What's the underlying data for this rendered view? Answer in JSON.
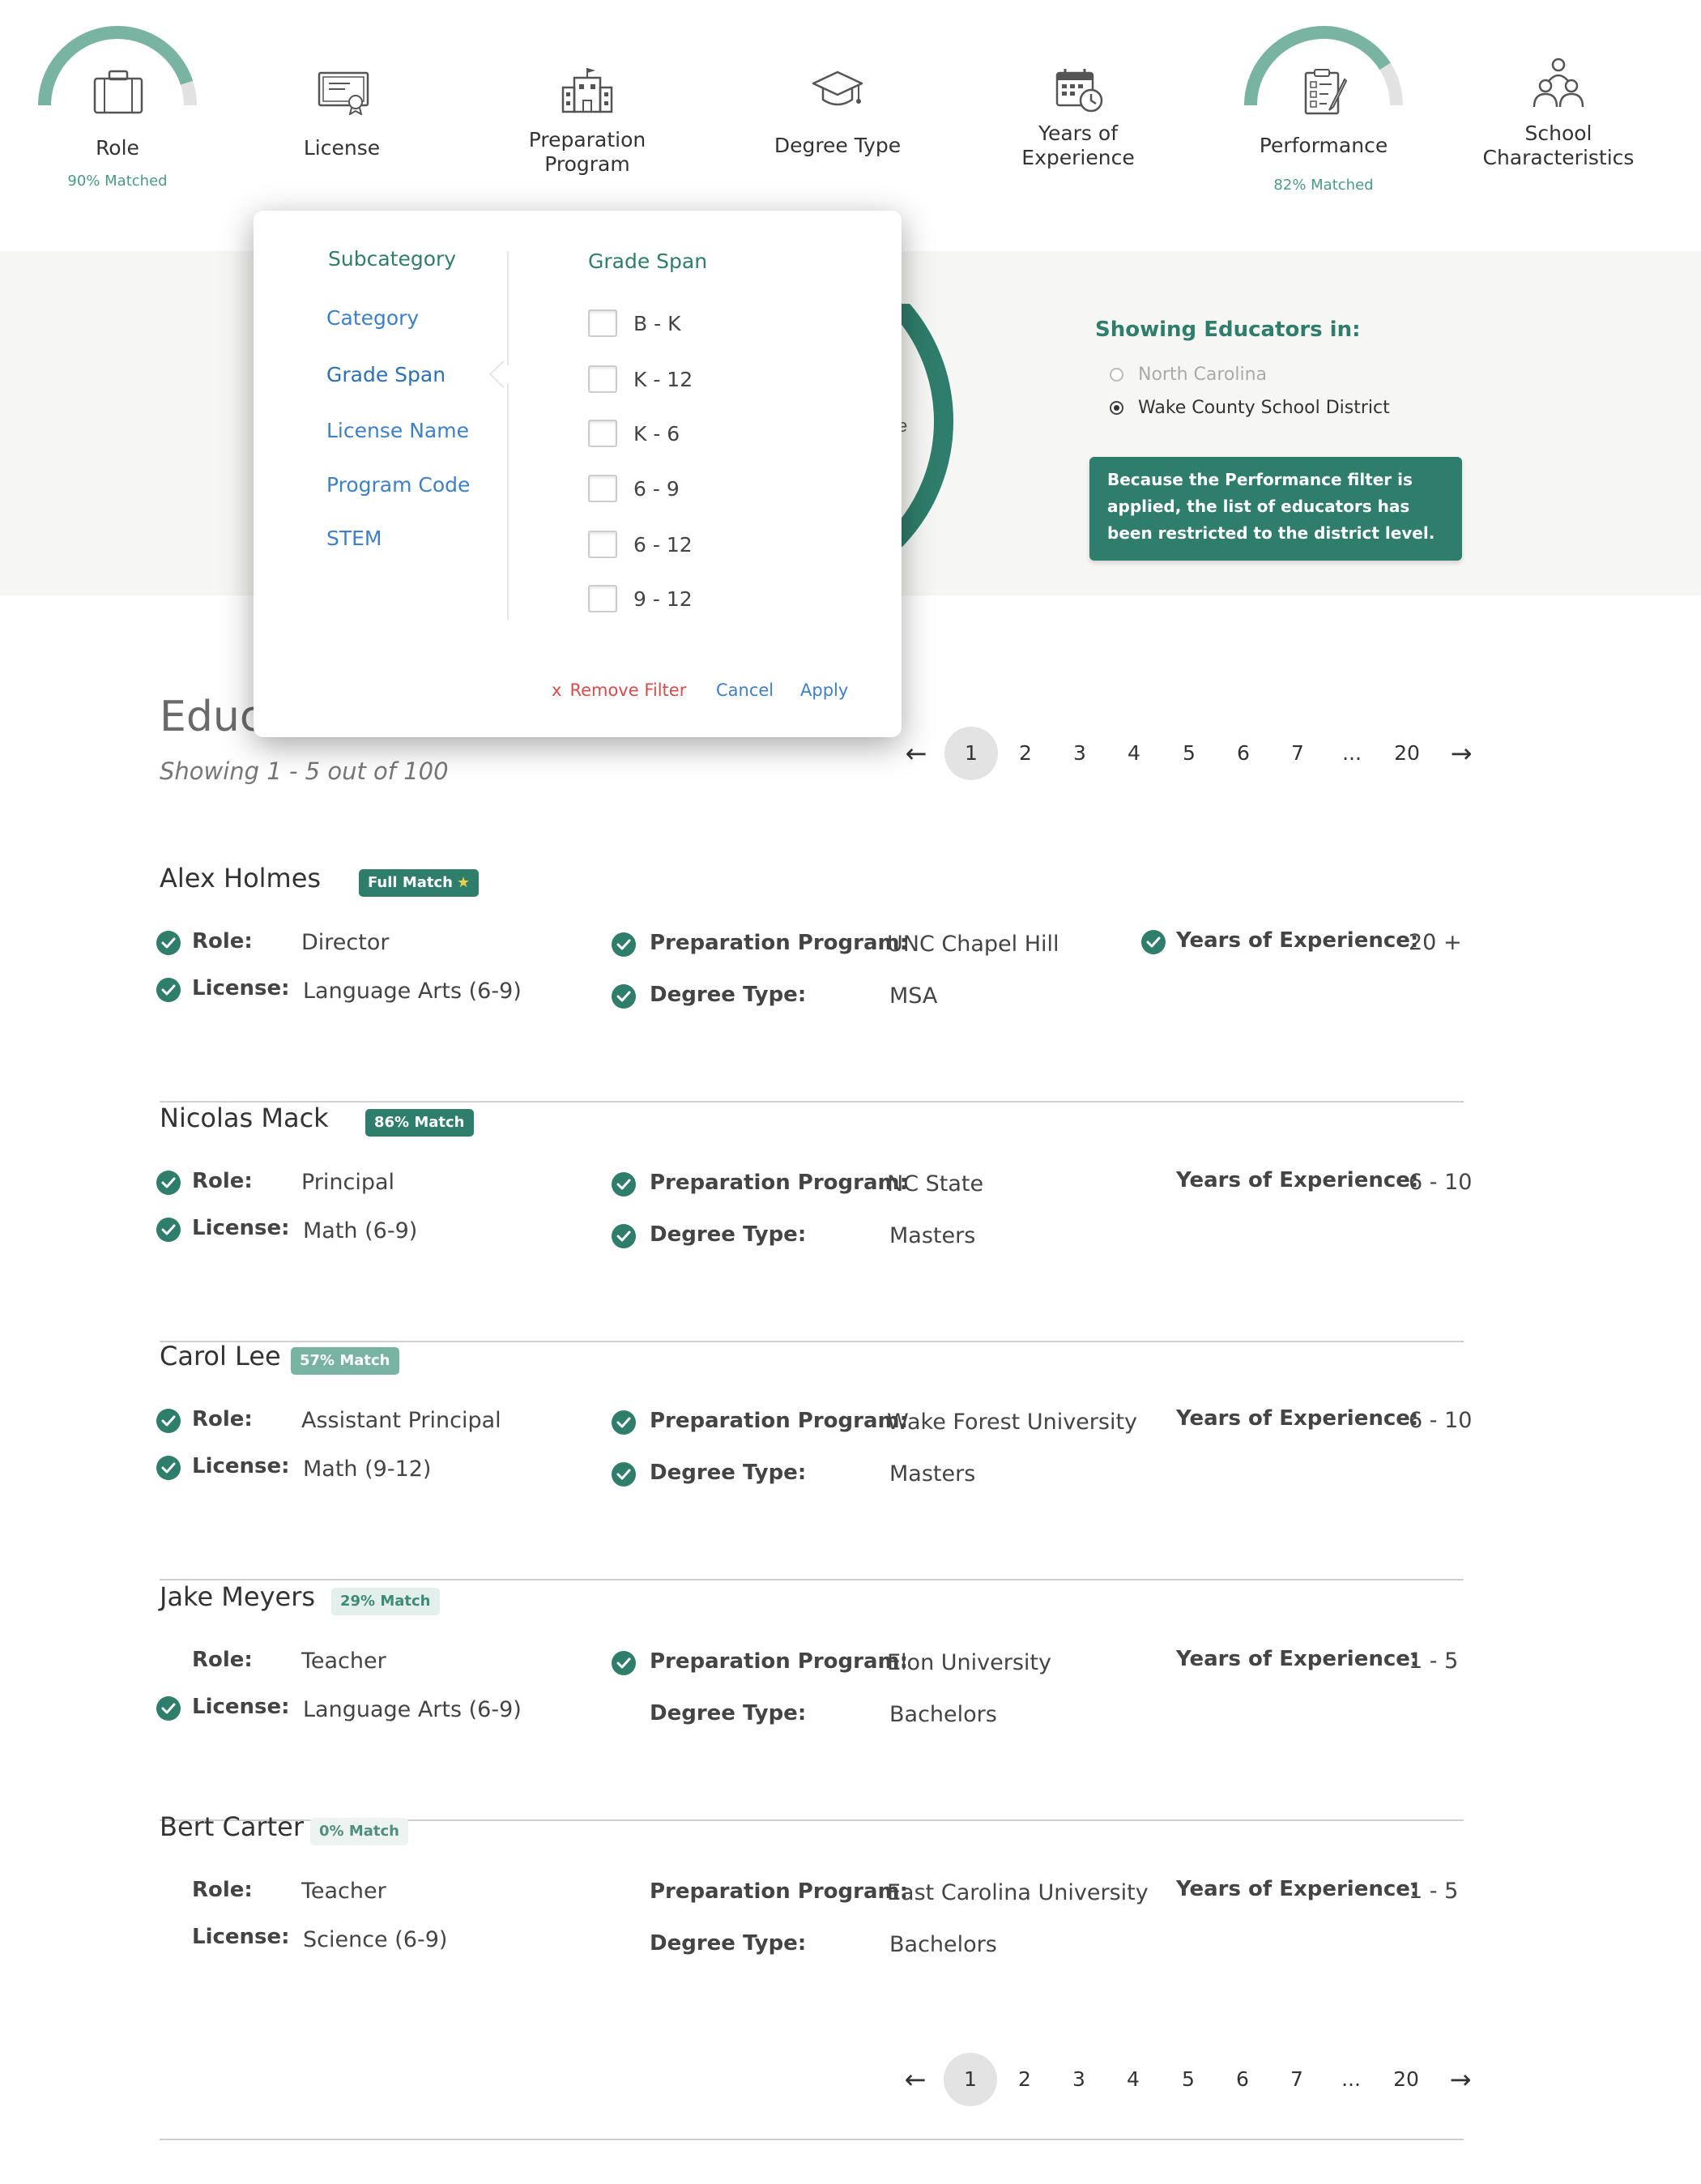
{
  "filters": [
    {
      "label": "Role",
      "match": "90% Matched",
      "gauge_fraction": 0.9
    },
    {
      "label": "License"
    },
    {
      "label": "Preparation\nProgram"
    },
    {
      "label": "Degree Type"
    },
    {
      "label": "Years of\nExperience"
    },
    {
      "label": "Performance",
      "match": "82% Matched",
      "gauge_fraction": 0.82
    },
    {
      "label": "School\nCharacteristics"
    }
  ],
  "location": {
    "title": "Showing Educators in:",
    "options": [
      {
        "label": "North Carolina",
        "selected": false
      },
      {
        "label": "Wake County School District",
        "selected": true
      }
    ],
    "note": "Because the Performance filter is applied, the list of educators has been restricted to the district level."
  },
  "ring_text": "e",
  "results": {
    "title": "Educ",
    "subtitle": "Showing 1 - 5 out of 100",
    "pages": [
      "1",
      "2",
      "3",
      "4",
      "5",
      "6",
      "7",
      "...",
      "20"
    ],
    "current_page": "1",
    "prev_icon": "arrow-left",
    "next_icon": "arrow-right"
  },
  "labels": {
    "role": "Role:",
    "license": "License:",
    "prep": "Preparation Program:",
    "degree": "Degree Type:",
    "years": "Years of Experience:"
  },
  "educators": [
    {
      "name": "Alex Holmes",
      "badge": "Full Match",
      "badge_star": "★",
      "badge_style": "full",
      "role": "Director",
      "license": "Language Arts (6-9)",
      "prep": "UNC Chapel Hill",
      "degree": "MSA",
      "years": "20 +",
      "checks": {
        "role": true,
        "license": true,
        "prep": true,
        "degree": true,
        "years": true
      }
    },
    {
      "name": "Nicolas Mack",
      "badge": "86% Match",
      "badge_style": "full",
      "role": "Principal",
      "license": "Math (6-9)",
      "prep": "NC State",
      "degree": "Masters",
      "years": "6 - 10",
      "checks": {
        "role": true,
        "license": true,
        "prep": true,
        "degree": true,
        "years": false
      }
    },
    {
      "name": "Carol Lee",
      "badge": "57% Match",
      "badge_style": "mid",
      "role": "Assistant Principal",
      "license": "Math (9-12)",
      "prep": "Wake Forest University",
      "degree": "Masters",
      "years": "6 - 10",
      "checks": {
        "role": true,
        "license": true,
        "prep": true,
        "degree": true,
        "years": false
      }
    },
    {
      "name": "Jake Meyers",
      "badge": "29% Match",
      "badge_style": "low",
      "role": "Teacher",
      "license": "Language Arts (6-9)",
      "prep": "Elon University",
      "degree": "Bachelors",
      "years": "1 - 5",
      "checks": {
        "role": false,
        "license": true,
        "prep": true,
        "degree": false,
        "years": false
      }
    },
    {
      "name": "Bert Carter",
      "badge": "0% Match",
      "badge_style": "none",
      "role": "Teacher",
      "license": "Science (6-9)",
      "prep": "East Carolina University",
      "degree": "Bachelors",
      "years": "1 - 5",
      "checks": {
        "role": false,
        "license": false,
        "prep": false,
        "degree": false,
        "years": false
      }
    }
  ],
  "dropdown": {
    "subcategory_title": "Subcategory",
    "subcategories": [
      "Category",
      "Grade Span",
      "License Name",
      "Program Code",
      "STEM"
    ],
    "active_subcategory": "Grade Span",
    "options_title": "Grade Span",
    "options": [
      "B - K",
      "K - 12",
      "K - 6",
      "6 - 9",
      "6 - 12",
      "9 - 12"
    ],
    "remove_label": "Remove Filter",
    "remove_icon": "x",
    "cancel_label": "Cancel",
    "apply_label": "Apply"
  },
  "colors": {
    "accent": "#2f7d6b",
    "gauge": "#79b3a2",
    "gauge_track": "#e2e2e2",
    "link": "#3d7fc9",
    "danger": "#d94b4b"
  }
}
